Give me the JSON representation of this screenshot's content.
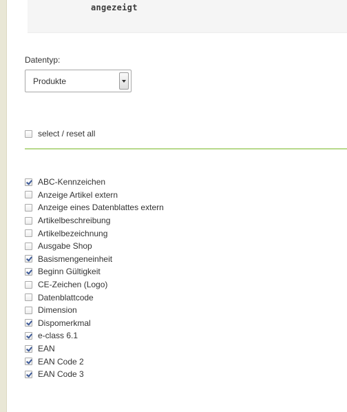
{
  "code_block": {
    "text": "angezeigt"
  },
  "datentyp": {
    "label": "Datentyp:",
    "selected": "Produkte"
  },
  "select_reset_all": {
    "label": "select / reset all",
    "checked": false
  },
  "fields": [
    {
      "label": "ABC-Kennzeichen",
      "checked": true
    },
    {
      "label": "Anzeige Artikel extern",
      "checked": false
    },
    {
      "label": "Anzeige eines Datenblattes extern",
      "checked": false
    },
    {
      "label": "Artikelbeschreibung",
      "checked": false
    },
    {
      "label": "Artikelbezeichnung",
      "checked": false
    },
    {
      "label": "Ausgabe Shop",
      "checked": false
    },
    {
      "label": "Basismengeneinheit",
      "checked": true
    },
    {
      "label": "Beginn Gültigkeit",
      "checked": true
    },
    {
      "label": "CE-Zeichen (Logo)",
      "checked": false
    },
    {
      "label": "Datenblattcode",
      "checked": false
    },
    {
      "label": "Dimension",
      "checked": false
    },
    {
      "label": "Dispomerkmal",
      "checked": true
    },
    {
      "label": "e-class 6.1",
      "checked": true
    },
    {
      "label": "EAN",
      "checked": true
    },
    {
      "label": "EAN Code 2",
      "checked": true
    },
    {
      "label": "EAN Code 3",
      "checked": true
    }
  ]
}
